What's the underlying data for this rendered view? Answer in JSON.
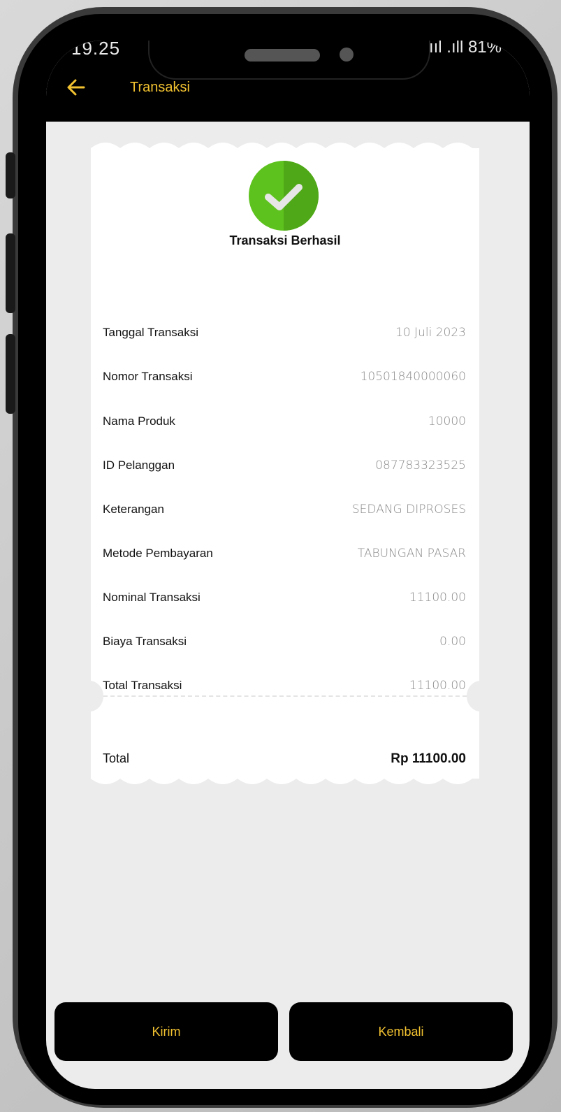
{
  "status_bar": {
    "time": "19.25",
    "indicators": "ııl .ıll 81%"
  },
  "header": {
    "title": "Transaksi",
    "back_icon": "arrow-left-icon"
  },
  "receipt": {
    "status_title": "Transaksi Berhasil",
    "status_icon": "check-circle-icon",
    "rows": [
      {
        "label": "Tanggal Transaksi",
        "value": "10 Juli 2023"
      },
      {
        "label": "Nomor Transaksi",
        "value": "10501840000060"
      },
      {
        "label": "Nama Produk",
        "value": "10000"
      },
      {
        "label": "ID Pelanggan",
        "value": "087783323525"
      },
      {
        "label": "Keterangan",
        "value": "SEDANG DIPROSES"
      },
      {
        "label": "Metode Pembayaran",
        "value": "TABUNGAN PASAR"
      },
      {
        "label": "Nominal Transaksi",
        "value": "11100.00"
      },
      {
        "label": "Biaya Transaksi",
        "value": "0.00"
      },
      {
        "label": "Total Transaksi",
        "value": "11100.00"
      }
    ],
    "total_label": "Total",
    "total_value": "Rp 11100.00"
  },
  "actions": {
    "send_label": "Kirim",
    "back_label": "Kembali"
  },
  "colors": {
    "accent": "#f2c230",
    "success": "#5ec21e",
    "background": "#ececec"
  }
}
